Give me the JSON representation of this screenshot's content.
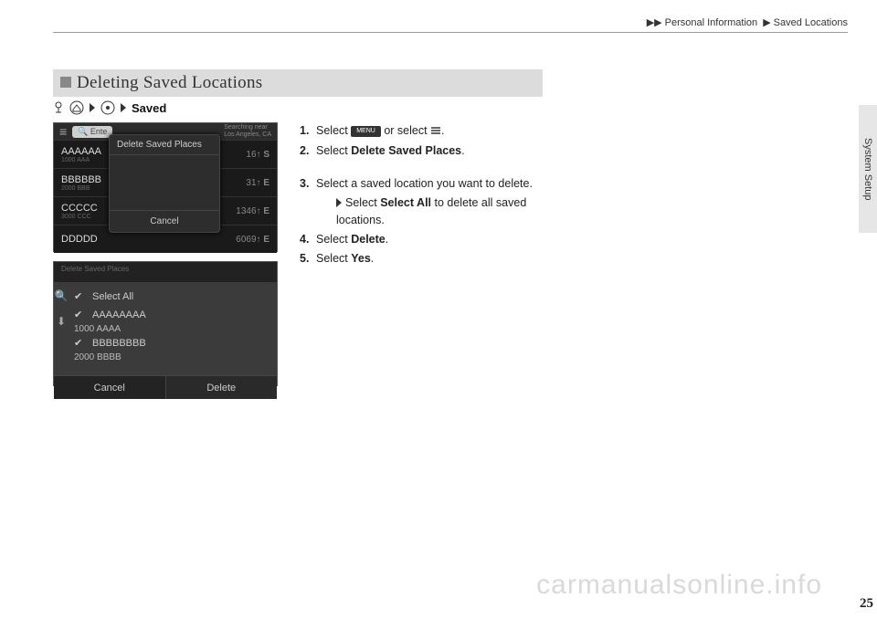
{
  "breadcrumb": {
    "level1": "Personal Information",
    "level2": "Saved Locations"
  },
  "side_tab": "System Setup",
  "page_number": "25",
  "watermark": "carmanualsonline.info",
  "section": {
    "title": "Deleting Saved Locations",
    "path_end": "Saved"
  },
  "shot1": {
    "search_placeholder": "Ente",
    "searching_line1": "Searching near",
    "searching_line2": "Los Angeles, CA",
    "rows": [
      {
        "name": "AAAAAA",
        "sub": "1000 AAA",
        "dist": "16",
        "dir": "S"
      },
      {
        "name": "BBBBBB",
        "sub": "2000 BBB",
        "dist": "31",
        "dir": "E"
      },
      {
        "name": "CCCCC",
        "sub": "3000 CCC",
        "dist": "1346",
        "dir": "E"
      },
      {
        "name": "DDDDD",
        "sub": "",
        "dist": "6069",
        "dir": "E"
      }
    ],
    "dialog_title": "Delete Saved Places",
    "dialog_cancel": "Cancel"
  },
  "shot2": {
    "header": "Delete Saved Places",
    "rows": [
      {
        "name": "Select All",
        "sub": ""
      },
      {
        "name": "AAAAAAAA",
        "sub": "1000 AAAA"
      },
      {
        "name": "BBBBBBBB",
        "sub": "2000 BBBB"
      }
    ],
    "cancel": "Cancel",
    "delete": "Delete"
  },
  "steps": {
    "s1a": "Select ",
    "s1b": " or select ",
    "s1c": ".",
    "menu_label": "MENU",
    "s2": "Select ",
    "s2b": "Delete Saved Places",
    "s2c": ".",
    "s3": "Select a saved location you want to delete.",
    "s3sub_a": "Select ",
    "s3sub_b": "Select All",
    "s3sub_c": " to delete all saved locations.",
    "s4": "Select ",
    "s4b": "Delete",
    "s4c": ".",
    "s5": "Select ",
    "s5b": "Yes",
    "s5c": "."
  }
}
